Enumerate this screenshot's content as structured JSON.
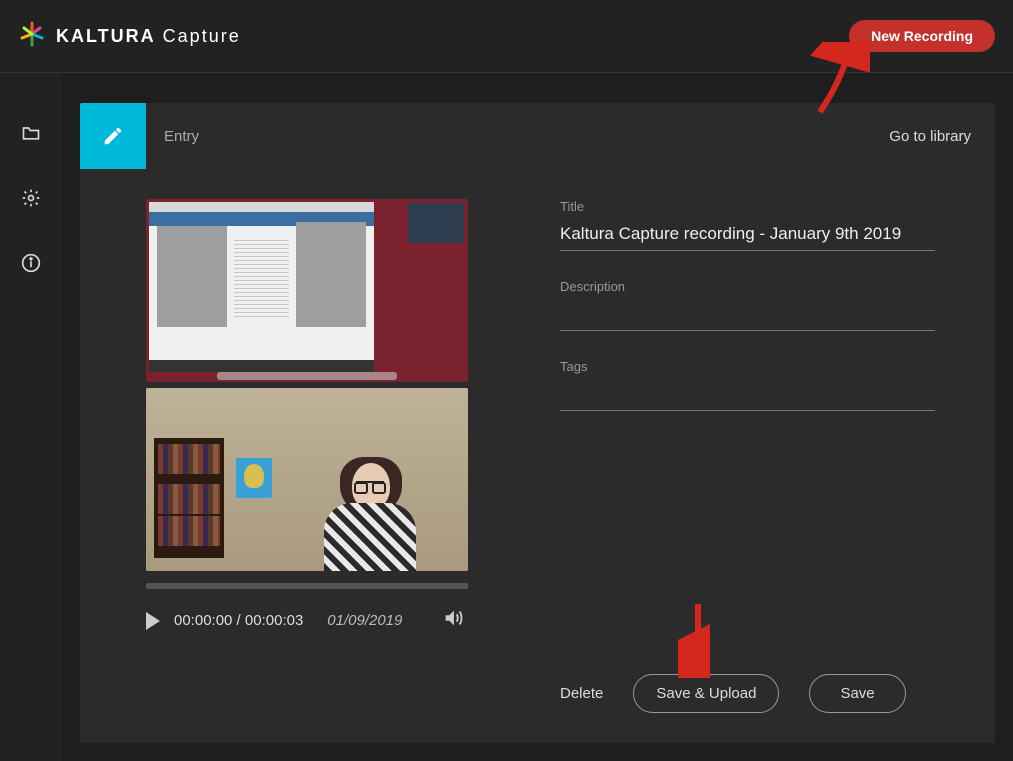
{
  "app": {
    "brand_strong": "KALTURA",
    "brand_light": "Capture"
  },
  "header": {
    "new_recording_label": "New Recording"
  },
  "sidebar_icons": [
    "folder-icon",
    "gear-icon",
    "info-icon"
  ],
  "stage": {
    "tab_label": "Entry",
    "go_to_library_label": "Go to library"
  },
  "player": {
    "current_time": "00:00:00",
    "duration": "00:00:03",
    "date": "01/09/2019"
  },
  "form": {
    "title_label": "Title",
    "title_value": "Kaltura Capture recording - January 9th 2019",
    "description_label": "Description",
    "description_value": "",
    "tags_label": "Tags",
    "tags_value": ""
  },
  "actions": {
    "delete_label": "Delete",
    "save_upload_label": "Save & Upload",
    "save_label": "Save"
  },
  "annotations": {
    "arrow_to_new_recording": true,
    "arrow_to_save_upload": true
  }
}
